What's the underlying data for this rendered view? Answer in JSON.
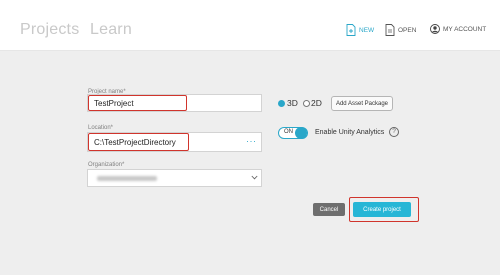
{
  "nav": {
    "tabs": [
      {
        "label": "Projects"
      },
      {
        "label": "Learn"
      }
    ],
    "actions": {
      "new_label": "NEW",
      "open_label": "OPEN",
      "account_label": "MY ACCOUNT"
    }
  },
  "form": {
    "project_name": {
      "label": "Project name*",
      "value": "TestProject"
    },
    "location": {
      "label": "Location*",
      "value": "C:\\TestProjectDirectory",
      "browse_label": "···"
    },
    "organization": {
      "label": "Organization*"
    }
  },
  "options": {
    "mode_3d": {
      "label": "3D",
      "selected": true
    },
    "mode_2d": {
      "label": "2D",
      "selected": false
    },
    "add_asset_package": "Add Asset Package",
    "analytics": {
      "toggle_state": "ON",
      "label": "Enable Unity Analytics",
      "help": "?"
    }
  },
  "buttons": {
    "cancel": "Cancel",
    "create": "Create project"
  },
  "colors": {
    "accent": "#2aa7c9",
    "highlight": "#d0342c",
    "cancel_bg": "#6e6e6e",
    "create_bg": "#27b6d6"
  }
}
